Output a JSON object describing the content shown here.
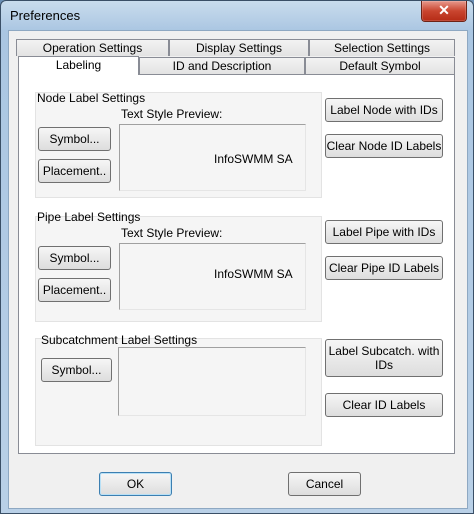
{
  "window": {
    "title": "Preferences",
    "close_label": "✕"
  },
  "tabs": {
    "row1": [
      "Operation Settings",
      "Display Settings",
      "Selection Settings"
    ],
    "row2": [
      "Labeling",
      "ID and Description",
      "Default Symbol"
    ],
    "active": "Labeling"
  },
  "node": {
    "group_label": "Node Label Settings",
    "preview_label": "Text Style Preview:",
    "preview_text": "InfoSWMM SA",
    "symbol_button": "Symbol...",
    "placement_button": "Placement..",
    "label_ids_button": "Label Node with IDs",
    "clear_ids_button": "Clear Node ID Labels"
  },
  "pipe": {
    "group_label": "Pipe Label Settings",
    "preview_label": "Text Style Preview:",
    "preview_text": "InfoSWMM SA",
    "symbol_button": "Symbol...",
    "placement_button": "Placement..",
    "label_ids_button": "Label Pipe with IDs",
    "clear_ids_button": "Clear Pipe ID Labels"
  },
  "subcatchment": {
    "group_label": "Subcatchment Label Settings",
    "symbol_button": "Symbol...",
    "label_ids_button": "Label Subcatch. with IDs",
    "clear_ids_button": "Clear ID Labels"
  },
  "footer": {
    "ok_button": "OK",
    "cancel_button": "Cancel"
  }
}
